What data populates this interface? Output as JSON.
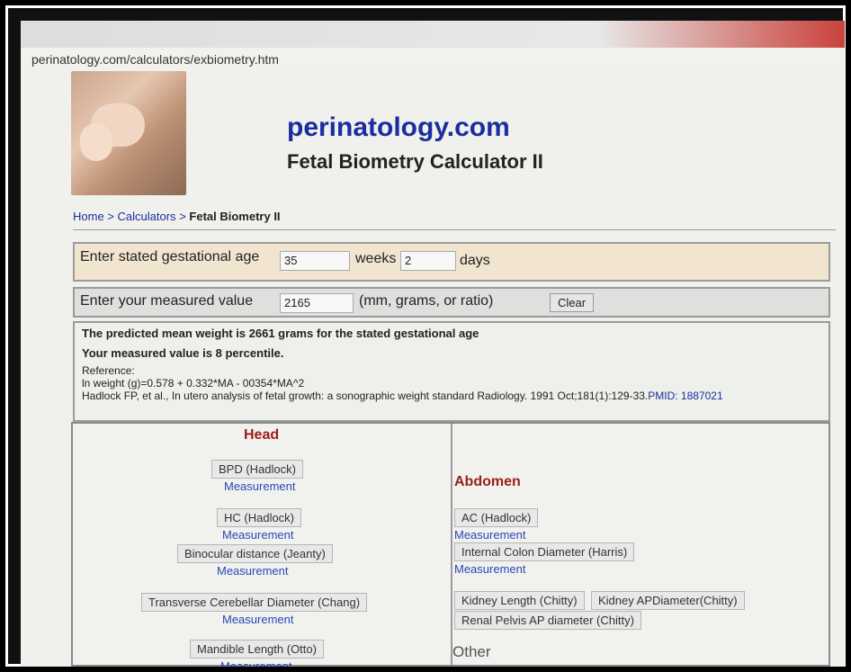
{
  "browser": {
    "url": "perinatology.com/calculators/exbiometry.htm"
  },
  "header": {
    "site_name": "perinatology.com",
    "title": "Fetal Biometry Calculator II"
  },
  "breadcrumb": {
    "home": "Home",
    "sep1": ">",
    "calculators": "Calculators",
    "sep2": ">",
    "current": "Fetal Biometry II"
  },
  "ga_row": {
    "label": "Enter stated  gestational age",
    "weeks_value": "35",
    "weeks_label": "weeks",
    "days_value": "2",
    "days_label": "days"
  },
  "measure_row": {
    "label": "Enter your measured value",
    "value": "2165",
    "units": "(mm, grams, or ratio)",
    "clear_label": "Clear"
  },
  "result": {
    "predicted": "The predicted mean weight is 2661 grams for the stated gestational age",
    "percentile": "Your measured value is 8 percentile.",
    "reference_label": "Reference:",
    "formula": "ln weight (g)=0.578 + 0.332*MA - 00354*MA^2",
    "citation": "Hadlock FP, et al., In utero analysis of fetal growth: a sonographic weight standard Radiology. 1991 Oct;181(1):129-33.",
    "pmid": "PMID: 1887021"
  },
  "head": {
    "title": "Head",
    "bpd": "BPD (Hadlock)",
    "hc": "HC (Hadlock)",
    "binocular": "Binocular distance (Jeanty)",
    "tcd": "Transverse Cerebellar Diameter (Chang)",
    "mandible": "Mandible Length (Otto)",
    "measurement": "Measurement"
  },
  "abdomen": {
    "title": "Abdomen",
    "ac": "AC (Hadlock)",
    "icd": "Internal Colon Diameter (Harris)",
    "kidney_length": "Kidney Length (Chitty)",
    "kidney_ap": "Kidney APDiameter(Chitty)",
    "renal_pelvis": "Renal Pelvis AP diameter (Chitty)",
    "measurement": "Measurement",
    "other": "Other"
  }
}
